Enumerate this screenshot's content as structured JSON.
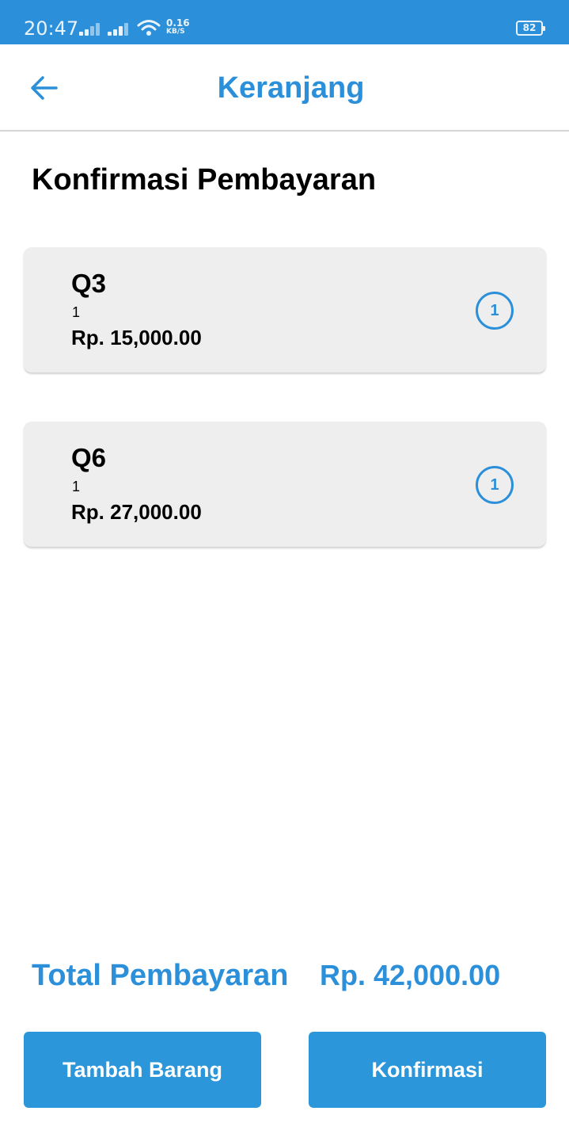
{
  "status_bar": {
    "time": "20:47",
    "net_speed_value": "0.16",
    "net_speed_unit": "KB/S",
    "battery": "82",
    "icons": [
      "signal-icon",
      "signal-icon",
      "wifi-icon",
      "battery-icon"
    ]
  },
  "app_bar": {
    "title": "Keranjang",
    "back_icon": "arrow-left-icon"
  },
  "heading": "Konfirmasi Pembayaran",
  "cart": {
    "items": [
      {
        "name": "Q3",
        "qty": "1",
        "price": "Rp. 15,000.00",
        "badge": "1"
      },
      {
        "name": "Q6",
        "qty": "1",
        "price": "Rp. 27,000.00",
        "badge": "1"
      }
    ]
  },
  "total": {
    "label": "Total Pembayaran",
    "value": "Rp. 42,000.00"
  },
  "buttons": {
    "add": "Tambah Barang",
    "confirm": "Konfirmasi"
  },
  "colors": {
    "accent": "#2b8fd9",
    "status_bar": "#2b8fd9",
    "card_bg": "#eeeeee",
    "button_bg": "#2b96d9"
  }
}
